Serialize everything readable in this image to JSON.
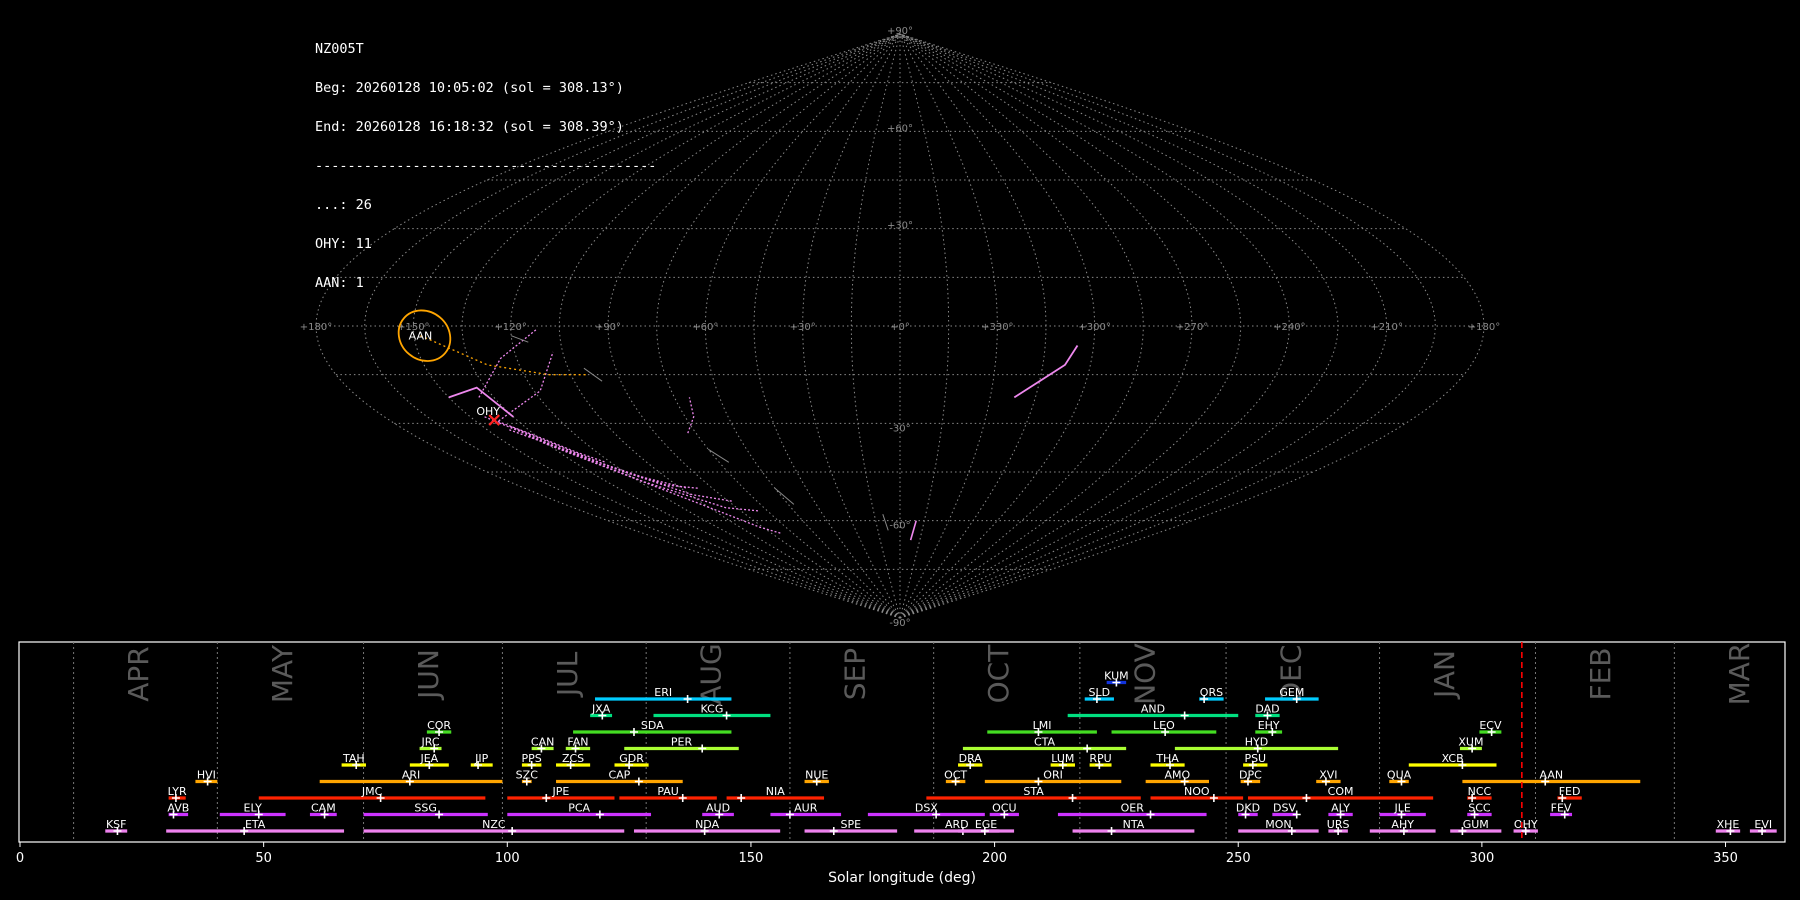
{
  "info": {
    "station": "NZ005T",
    "beg": "Beg: 20260128 10:05:02 (sol = 308.13°)",
    "end": "End: 20260128 16:18:32 (sol = 308.39°)",
    "separator": "------------------------------------------",
    "counts": [
      "...: 26",
      "OHY: 11",
      "AAN: 1"
    ]
  },
  "sky_map": {
    "projection": "sinusoidal",
    "lon_labels": [
      "+180°",
      "+150°",
      "+120°",
      "+90°",
      "+60°",
      "+30°",
      "+0°",
      "+330°",
      "+300°",
      "+270°",
      "+240°",
      "+210°",
      "+180°"
    ],
    "lat_labels": [
      "+90°",
      "+60°",
      "+30°",
      "-30°",
      "-60°",
      "-90°"
    ],
    "radiants": [
      {
        "name": "AAN",
        "lon": 148,
        "lat": -3,
        "color": "#ffa500"
      },
      {
        "name": "OHY",
        "lon": 143,
        "lat": -29,
        "color": "#ff66ff"
      }
    ]
  },
  "chart_data": {
    "type": "gantt",
    "xlabel": "Solar longitude (deg)",
    "xlim": [
      0,
      362
    ],
    "xticks": [
      0,
      50,
      100,
      150,
      200,
      250,
      300,
      350
    ],
    "current_sol": 308.2,
    "months": [
      {
        "label": "APR",
        "start": 11
      },
      {
        "label": "MAY",
        "start": 40.5
      },
      {
        "label": "JUN",
        "start": 70.5
      },
      {
        "label": "JUL",
        "start": 99
      },
      {
        "label": "AUG",
        "start": 128.5
      },
      {
        "label": "SEP",
        "start": 158
      },
      {
        "label": "OCT",
        "start": 187.5
      },
      {
        "label": "NOV",
        "start": 217.5
      },
      {
        "label": "DEC",
        "start": 247.5
      },
      {
        "label": "JAN",
        "start": 279
      },
      {
        "label": "FEB",
        "start": 311
      },
      {
        "label": "MAR",
        "start": 339.5
      }
    ],
    "showers": [
      {
        "code": "KSF",
        "start": 17.5,
        "end": 22,
        "peak": 20,
        "row": 0,
        "color": "#ee82ee"
      },
      {
        "code": "ETA",
        "start": 30,
        "end": 66.5,
        "peak": 46,
        "row": 0,
        "color": "#ee82ee"
      },
      {
        "code": "NZC",
        "start": 70.5,
        "end": 124,
        "peak": 101,
        "row": 0,
        "color": "#ee82ee"
      },
      {
        "code": "NDA",
        "start": 126,
        "end": 156,
        "peak": 140.5,
        "row": 0,
        "color": "#ee82ee"
      },
      {
        "code": "SPE",
        "start": 161,
        "end": 180,
        "peak": 167,
        "row": 0,
        "color": "#ee82ee"
      },
      {
        "code": "ARD",
        "start": 183.5,
        "end": 201,
        "peak": 193.5,
        "row": 0,
        "color": "#ee82ee"
      },
      {
        "code": "EGE",
        "start": 192.5,
        "end": 204,
        "peak": 198,
        "row": 0,
        "color": "#ee82ee"
      },
      {
        "code": "NTA",
        "start": 216,
        "end": 241,
        "peak": 224,
        "row": 0,
        "color": "#ee82ee"
      },
      {
        "code": "MON",
        "start": 250,
        "end": 266.5,
        "peak": 261,
        "row": 0,
        "color": "#ee82ee"
      },
      {
        "code": "URS",
        "start": 268.5,
        "end": 272.5,
        "peak": 270.5,
        "row": 0,
        "color": "#ee82ee"
      },
      {
        "code": "AHY",
        "start": 277,
        "end": 290.5,
        "peak": 284,
        "row": 0,
        "color": "#ee82ee"
      },
      {
        "code": "GUM",
        "start": 293.5,
        "end": 304,
        "peak": 296,
        "row": 0,
        "color": "#ee82ee"
      },
      {
        "code": "OHY",
        "start": 306.5,
        "end": 311.5,
        "peak": 309,
        "row": 0,
        "color": "#ee82ee"
      },
      {
        "code": "XHE",
        "start": 348,
        "end": 353,
        "peak": 351,
        "row": 0,
        "color": "#ee82ee"
      },
      {
        "code": "EVI",
        "start": 355,
        "end": 360.5,
        "peak": 357.5,
        "row": 0,
        "color": "#ee82ee"
      },
      {
        "code": "AVB",
        "start": 30.5,
        "end": 34.5,
        "peak": 31.5,
        "row": 1,
        "color": "#cc33ff"
      },
      {
        "code": "ELY",
        "start": 41,
        "end": 54.5,
        "peak": 49,
        "row": 1,
        "color": "#cc33ff"
      },
      {
        "code": "CAM",
        "start": 59.5,
        "end": 65,
        "peak": 62.5,
        "row": 1,
        "color": "#cc33ff"
      },
      {
        "code": "SSG",
        "start": 70.5,
        "end": 96,
        "peak": 86,
        "row": 1,
        "color": "#cc33ff"
      },
      {
        "code": "PCA",
        "start": 100,
        "end": 129.5,
        "peak": 119,
        "row": 1,
        "color": "#cc33ff"
      },
      {
        "code": "AUD",
        "start": 140,
        "end": 146.5,
        "peak": 143.5,
        "row": 1,
        "color": "#cc33ff"
      },
      {
        "code": "AUR",
        "start": 154,
        "end": 168.5,
        "peak": 158,
        "row": 1,
        "color": "#cc33ff"
      },
      {
        "code": "DSX",
        "start": 174,
        "end": 198,
        "peak": 188,
        "row": 1,
        "color": "#cc33ff"
      },
      {
        "code": "OCU",
        "start": 199,
        "end": 205,
        "peak": 202,
        "row": 1,
        "color": "#cc33ff"
      },
      {
        "code": "OER",
        "start": 213,
        "end": 243.5,
        "peak": 232,
        "row": 1,
        "color": "#cc33ff"
      },
      {
        "code": "DKD",
        "start": 250,
        "end": 254,
        "peak": 251.5,
        "row": 1,
        "color": "#cc33ff"
      },
      {
        "code": "DSV",
        "start": 257,
        "end": 262,
        "peak": 262,
        "row": 1,
        "color": "#cc33ff"
      },
      {
        "code": "ALY",
        "start": 268.5,
        "end": 273.5,
        "peak": 271,
        "row": 1,
        "color": "#cc33ff"
      },
      {
        "code": "JLE",
        "start": 279,
        "end": 288.5,
        "peak": 283.5,
        "row": 1,
        "color": "#cc33ff"
      },
      {
        "code": "SCC",
        "start": 297,
        "end": 302,
        "peak": 298.5,
        "row": 1,
        "color": "#cc33ff"
      },
      {
        "code": "FEV",
        "start": 314,
        "end": 318.5,
        "peak": 317,
        "row": 1,
        "color": "#cc33ff"
      },
      {
        "code": "LYR",
        "start": 30.5,
        "end": 34,
        "peak": 32,
        "row": 2,
        "color": "#ff2200"
      },
      {
        "code": "JMC",
        "start": 49,
        "end": 95.5,
        "peak": 74,
        "row": 2,
        "color": "#ff2200"
      },
      {
        "code": "JPE",
        "start": 100,
        "end": 122,
        "peak": 108,
        "row": 2,
        "color": "#ff2200"
      },
      {
        "code": "PAU",
        "start": 123,
        "end": 143,
        "peak": 136,
        "row": 2,
        "color": "#ff2200"
      },
      {
        "code": "NIA",
        "start": 145,
        "end": 165,
        "peak": 148,
        "row": 2,
        "color": "#ff2200"
      },
      {
        "code": "STA",
        "start": 186,
        "end": 230,
        "peak": 216,
        "row": 2,
        "color": "#ff2200"
      },
      {
        "code": "NOO",
        "start": 232,
        "end": 251,
        "peak": 245,
        "row": 2,
        "color": "#ff2200"
      },
      {
        "code": "COM",
        "start": 252,
        "end": 290,
        "peak": 264,
        "row": 2,
        "color": "#ff2200"
      },
      {
        "code": "NCC",
        "start": 297,
        "end": 302,
        "peak": 298,
        "row": 2,
        "color": "#ff2200"
      },
      {
        "code": "FED",
        "start": 315.5,
        "end": 320.5,
        "peak": 316.5,
        "row": 2,
        "color": "#ff2200"
      },
      {
        "code": "HVI",
        "start": 36,
        "end": 40.5,
        "peak": 38.5,
        "row": 3,
        "color": "#ffa500"
      },
      {
        "code": "ARI",
        "start": 61.5,
        "end": 99,
        "peak": 80,
        "row": 3,
        "color": "#ffa500"
      },
      {
        "code": "SZC",
        "start": 103,
        "end": 105,
        "peak": 104,
        "row": 3,
        "color": "#ffa500"
      },
      {
        "code": "CAP",
        "start": 110,
        "end": 136,
        "peak": 127,
        "row": 3,
        "color": "#ffa500"
      },
      {
        "code": "NUE",
        "start": 161,
        "end": 166,
        "peak": 163.5,
        "row": 3,
        "color": "#ffa500"
      },
      {
        "code": "OCT",
        "start": 190,
        "end": 194,
        "peak": 192,
        "row": 3,
        "color": "#ffa500"
      },
      {
        "code": "ORI",
        "start": 198,
        "end": 226,
        "peak": 209,
        "row": 3,
        "color": "#ffa500"
      },
      {
        "code": "AMO",
        "start": 231,
        "end": 244,
        "peak": 239,
        "row": 3,
        "color": "#ffa500"
      },
      {
        "code": "DPC",
        "start": 250.5,
        "end": 254.5,
        "peak": 252,
        "row": 3,
        "color": "#ffa500"
      },
      {
        "code": "XVI",
        "start": 266,
        "end": 271,
        "peak": 268,
        "row": 3,
        "color": "#ffa500"
      },
      {
        "code": "QUA",
        "start": 281,
        "end": 285,
        "peak": 283.5,
        "row": 3,
        "color": "#ffa500"
      },
      {
        "code": "AAN",
        "start": 296,
        "end": 332.5,
        "peak": 313,
        "row": 3,
        "color": "#ffa500"
      },
      {
        "code": "TAH",
        "start": 66,
        "end": 71,
        "peak": 69,
        "row": 4,
        "color": "#ffff00"
      },
      {
        "code": "JEA",
        "start": 80,
        "end": 88,
        "peak": 84,
        "row": 4,
        "color": "#ffff00"
      },
      {
        "code": "JIP",
        "start": 92.5,
        "end": 97,
        "peak": 94,
        "row": 4,
        "color": "#ffff00"
      },
      {
        "code": "PPS",
        "start": 103,
        "end": 107,
        "peak": 105,
        "row": 4,
        "color": "#ffff00"
      },
      {
        "code": "ZCS",
        "start": 110,
        "end": 117,
        "peak": 113,
        "row": 4,
        "color": "#ffff00"
      },
      {
        "code": "GDR",
        "start": 122,
        "end": 129,
        "peak": 125,
        "row": 4,
        "color": "#ffff00"
      },
      {
        "code": "DRA",
        "start": 192.5,
        "end": 197.5,
        "peak": 195,
        "row": 4,
        "color": "#ffff00"
      },
      {
        "code": "LUM",
        "start": 211.5,
        "end": 216.5,
        "peak": 214,
        "row": 4,
        "color": "#ffff00"
      },
      {
        "code": "RPU",
        "start": 219.5,
        "end": 224,
        "peak": 221.5,
        "row": 4,
        "color": "#ffff00"
      },
      {
        "code": "THA",
        "start": 232,
        "end": 239,
        "peak": 236,
        "row": 4,
        "color": "#ffff00"
      },
      {
        "code": "PSU",
        "start": 251,
        "end": 256,
        "peak": 253,
        "row": 4,
        "color": "#ffff00"
      },
      {
        "code": "XCB",
        "start": 285,
        "end": 303,
        "peak": 296,
        "row": 4,
        "color": "#ffff00"
      },
      {
        "code": "JRC",
        "start": 82,
        "end": 86.5,
        "peak": 85,
        "row": 5,
        "color": "#aaff33"
      },
      {
        "code": "CAN",
        "start": 105,
        "end": 109.5,
        "peak": 107,
        "row": 5,
        "color": "#aaff33"
      },
      {
        "code": "FAN",
        "start": 112,
        "end": 117,
        "peak": 114,
        "row": 5,
        "color": "#aaff33"
      },
      {
        "code": "PER",
        "start": 124,
        "end": 147.5,
        "peak": 140,
        "row": 5,
        "color": "#aaff33"
      },
      {
        "code": "CTA",
        "start": 193.5,
        "end": 227,
        "peak": 219,
        "row": 5,
        "color": "#aaff33"
      },
      {
        "code": "HYD",
        "start": 237,
        "end": 270.5,
        "peak": 254,
        "row": 5,
        "color": "#aaff33"
      },
      {
        "code": "XUM",
        "start": 295.5,
        "end": 300,
        "peak": 298,
        "row": 5,
        "color": "#aaff33"
      },
      {
        "code": "COR",
        "start": 83.5,
        "end": 88.5,
        "peak": 86,
        "row": 6,
        "color": "#44dd22"
      },
      {
        "code": "SDA",
        "start": 113.5,
        "end": 146,
        "peak": 126,
        "row": 6,
        "color": "#44dd22"
      },
      {
        "code": "LMI",
        "start": 198.5,
        "end": 221,
        "peak": 209,
        "row": 6,
        "color": "#44dd22"
      },
      {
        "code": "LEO",
        "start": 224,
        "end": 245.5,
        "peak": 235,
        "row": 6,
        "color": "#44dd22"
      },
      {
        "code": "EHY",
        "start": 253.5,
        "end": 259,
        "peak": 257,
        "row": 6,
        "color": "#44dd22"
      },
      {
        "code": "ECV",
        "start": 299.5,
        "end": 304,
        "peak": 302,
        "row": 6,
        "color": "#44dd22"
      },
      {
        "code": "JXA",
        "start": 117,
        "end": 121.5,
        "peak": 119.5,
        "row": 7,
        "color": "#00e080"
      },
      {
        "code": "KCG",
        "start": 130,
        "end": 154,
        "peak": 145,
        "row": 7,
        "color": "#00e080"
      },
      {
        "code": "AND",
        "start": 215,
        "end": 250,
        "peak": 239,
        "row": 7,
        "color": "#00e080"
      },
      {
        "code": "DAD",
        "start": 253.5,
        "end": 258.5,
        "peak": 256,
        "row": 7,
        "color": "#00e080"
      },
      {
        "code": "ERI",
        "start": 118,
        "end": 146,
        "peak": 137,
        "row": 8,
        "color": "#00ccff"
      },
      {
        "code": "SLD",
        "start": 218.5,
        "end": 224.5,
        "peak": 221,
        "row": 8,
        "color": "#00ccff"
      },
      {
        "code": "ORS",
        "start": 242,
        "end": 247,
        "peak": 243,
        "row": 8,
        "color": "#00ccff"
      },
      {
        "code": "GEM",
        "start": 255.5,
        "end": 266.5,
        "peak": 262,
        "row": 8,
        "color": "#00ccff"
      },
      {
        "code": "KUM",
        "start": 223,
        "end": 227,
        "peak": 225,
        "row": 9,
        "color": "#1133dd"
      }
    ]
  }
}
